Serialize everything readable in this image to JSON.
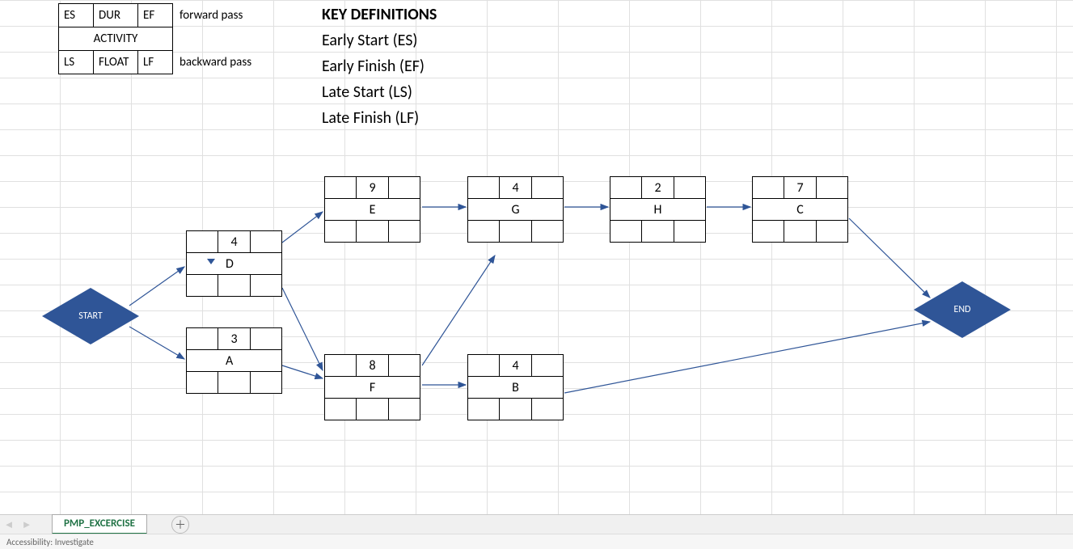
{
  "legend": {
    "es": "ES",
    "dur": "DUR",
    "ef": "EF",
    "forward": "forward pass",
    "activity": "ACTIVITY",
    "ls": "LS",
    "float": "FLOAT",
    "lf": "LF",
    "backward": "backward pass"
  },
  "definitions": {
    "title": "KEY DEFINITIONS",
    "es": "Early Start (ES)",
    "ef": "Early Finish (EF)",
    "ls": "Late Start (LS)",
    "lf": "Late Finish (LF)"
  },
  "nodes": {
    "start": "START",
    "end": "END",
    "D": {
      "dur": "4",
      "name": "D"
    },
    "A": {
      "dur": "3",
      "name": "A"
    },
    "E": {
      "dur": "9",
      "name": "E"
    },
    "F": {
      "dur": "8",
      "name": "F"
    },
    "G": {
      "dur": "4",
      "name": "G"
    },
    "B": {
      "dur": "4",
      "name": "B"
    },
    "H": {
      "dur": "2",
      "name": "H"
    },
    "C": {
      "dur": "7",
      "name": "C"
    }
  },
  "sheet": {
    "tab": "PMP_EXCERCISE",
    "status": "Accessibility: Investigate"
  }
}
